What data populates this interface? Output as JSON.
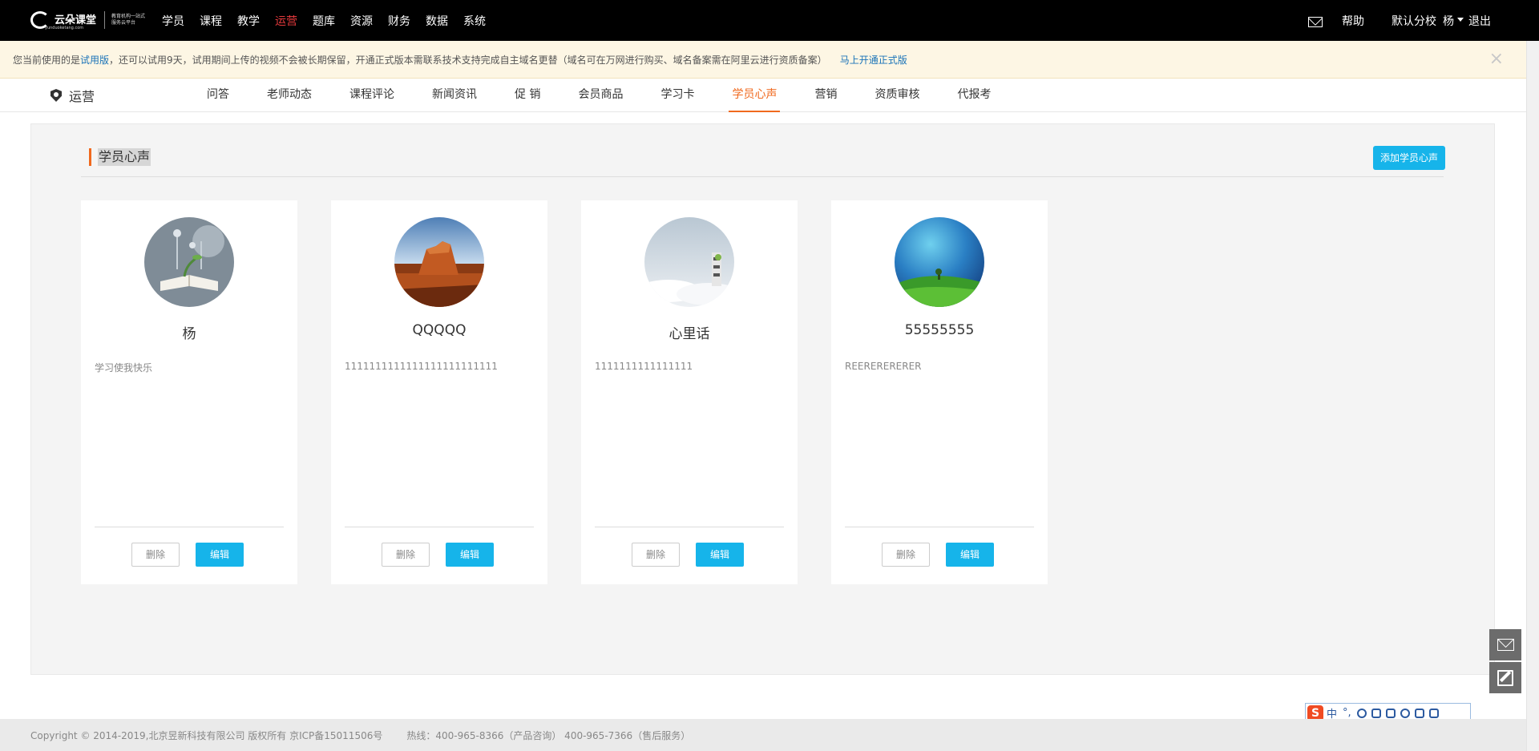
{
  "topbar": {
    "logo": {
      "title": "云朵课堂",
      "url": "yunduoketang.com",
      "slogan": "教育机构一站式服务云平台"
    },
    "nav": [
      {
        "label": "学员",
        "active": false
      },
      {
        "label": "课程",
        "active": false
      },
      {
        "label": "教学",
        "active": false
      },
      {
        "label": "运营",
        "active": true
      },
      {
        "label": "题库",
        "active": false
      },
      {
        "label": "资源",
        "active": false
      },
      {
        "label": "财务",
        "active": false
      },
      {
        "label": "数据",
        "active": false
      },
      {
        "label": "系统",
        "active": false
      }
    ],
    "help": "帮助",
    "campus": "默认分校",
    "user": "杨",
    "logout": "退出"
  },
  "notice": {
    "prefix": "您当前使用的是",
    "edition": "试用版",
    "body": "，还可以试用9天，试用期间上传的视频不会被长期保留，开通正式版本需联系技术支持完成自主域名更替（域名可在万网进行购买、域名备案需在阿里云进行资质备案）",
    "open_link": "马上开通正式版",
    "close": "×"
  },
  "subnav": {
    "title": "运营",
    "tabs": [
      {
        "label": "问答",
        "active": false
      },
      {
        "label": "老师动态",
        "active": false
      },
      {
        "label": "课程评论",
        "active": false
      },
      {
        "label": "新闻资讯",
        "active": false
      },
      {
        "label": "促 销",
        "active": false
      },
      {
        "label": "会员商品",
        "active": false
      },
      {
        "label": "学习卡",
        "active": false
      },
      {
        "label": "学员心声",
        "active": true
      },
      {
        "label": "营销",
        "active": false
      },
      {
        "label": "资质审核",
        "active": false
      },
      {
        "label": "代报考",
        "active": false
      }
    ]
  },
  "section": {
    "title": "学员心声",
    "add_button": "添加学员心声"
  },
  "cards": [
    {
      "name": "杨",
      "text": "学习使我快乐",
      "delete": "删除",
      "edit": "编辑"
    },
    {
      "name": "QQQQQ",
      "text": "1111111111111111111111111",
      "delete": "删除",
      "edit": "编辑"
    },
    {
      "name": "心里话",
      "text": "1111111111111111",
      "delete": "删除",
      "edit": "编辑"
    },
    {
      "name": "55555555",
      "text": "REERERERERER",
      "delete": "删除",
      "edit": "编辑"
    }
  ],
  "ime": {
    "logo": "S",
    "mode": "中",
    "punct": "°,"
  },
  "footer": {
    "copyright": "Copyright © 2014-2019,北京昱新科技有限公司 版权所有 京ICP备15011506号",
    "hotline": "热线：400-965-8366（产品咨询） 400-965-7366（售后服务）"
  },
  "colors": {
    "accent_orange": "#f0691e",
    "primary_blue": "#16b4ea",
    "nav_active_red": "#e4393c",
    "notice_bg": "#fdf6e4",
    "link_blue": "#1a73b8"
  }
}
